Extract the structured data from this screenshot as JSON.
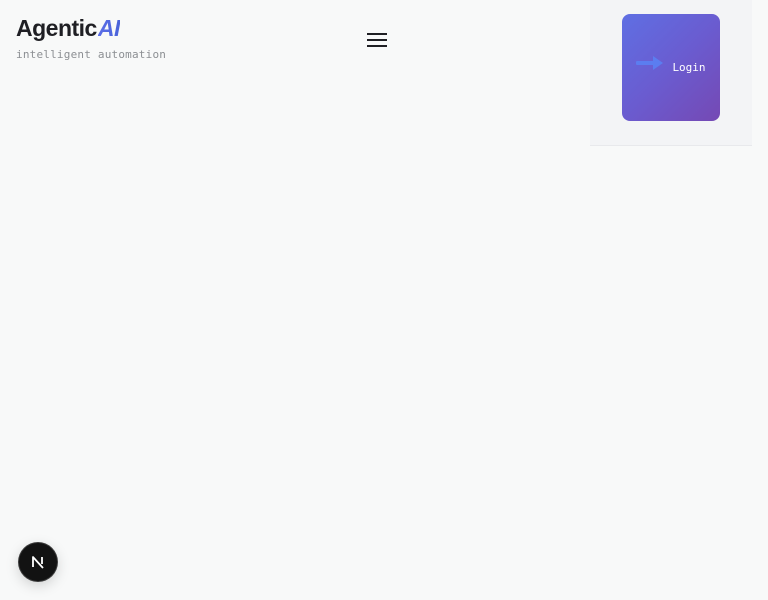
{
  "header": {
    "logo": {
      "main_text": "Agentic",
      "accent_text": "AI",
      "tagline": "intelligent automation"
    },
    "menu_icon": "hamburger-menu-icon"
  },
  "auth": {
    "login_label": "Login",
    "login_icon": "arrow-right-icon"
  },
  "dev_badge": {
    "icon": "nextjs-logo-icon",
    "letter": "N"
  },
  "colors": {
    "background": "#f8f9f9",
    "accent": "#4f67e0",
    "button_gradient_start": "#5f6fe3",
    "button_gradient_end": "#7549b4"
  }
}
